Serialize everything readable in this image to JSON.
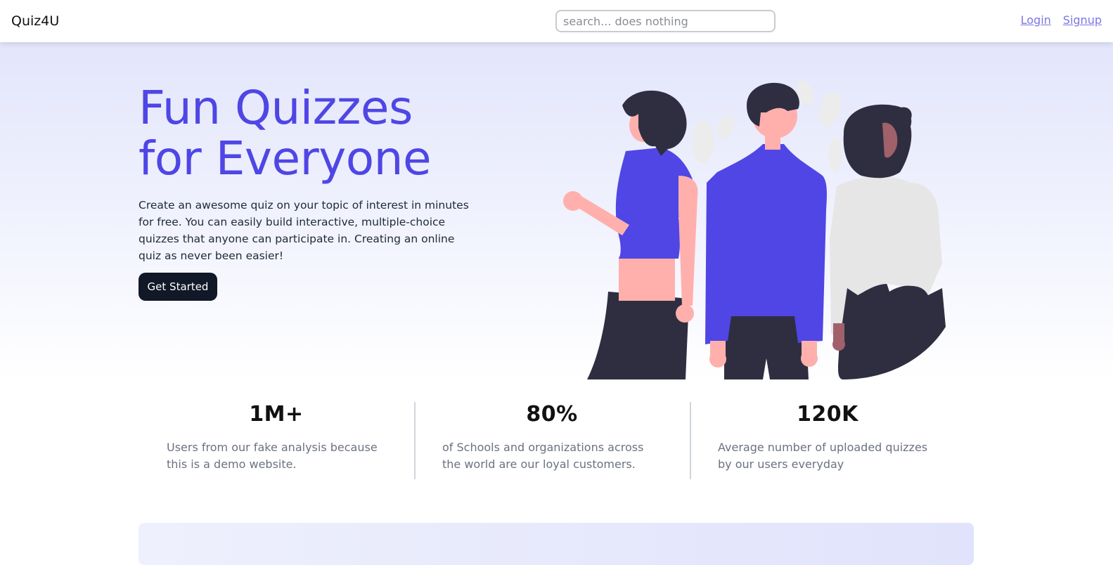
{
  "navbar": {
    "brand": "Quiz4U",
    "search_placeholder": "search... does nothing",
    "login_label": "Login",
    "signup_label": "Signup"
  },
  "hero": {
    "title_line1": "Fun Quizzes",
    "title_line2": "for Everyone",
    "description": "Create an awesome quiz on your topic of interest in minutes for free. You can easily build interactive, multiple-choice quizzes that anyone can participate in. Creating an online quiz as never been easier!",
    "cta_label": "Get Started"
  },
  "stats": [
    {
      "value": "1M+",
      "description": "Users from our fake analysis because this is a demo website."
    },
    {
      "value": "80%",
      "description": "of Schools and organizations across the world are our loyal customers."
    },
    {
      "value": "120K",
      "description": "Average number of uploaded quizzes by our users everyday"
    }
  ],
  "colors": {
    "accent": "#4f46e5",
    "dark": "#111827",
    "link": "#7b76e3",
    "skin": "#ffb0ad",
    "hair": "#2f2e41"
  }
}
